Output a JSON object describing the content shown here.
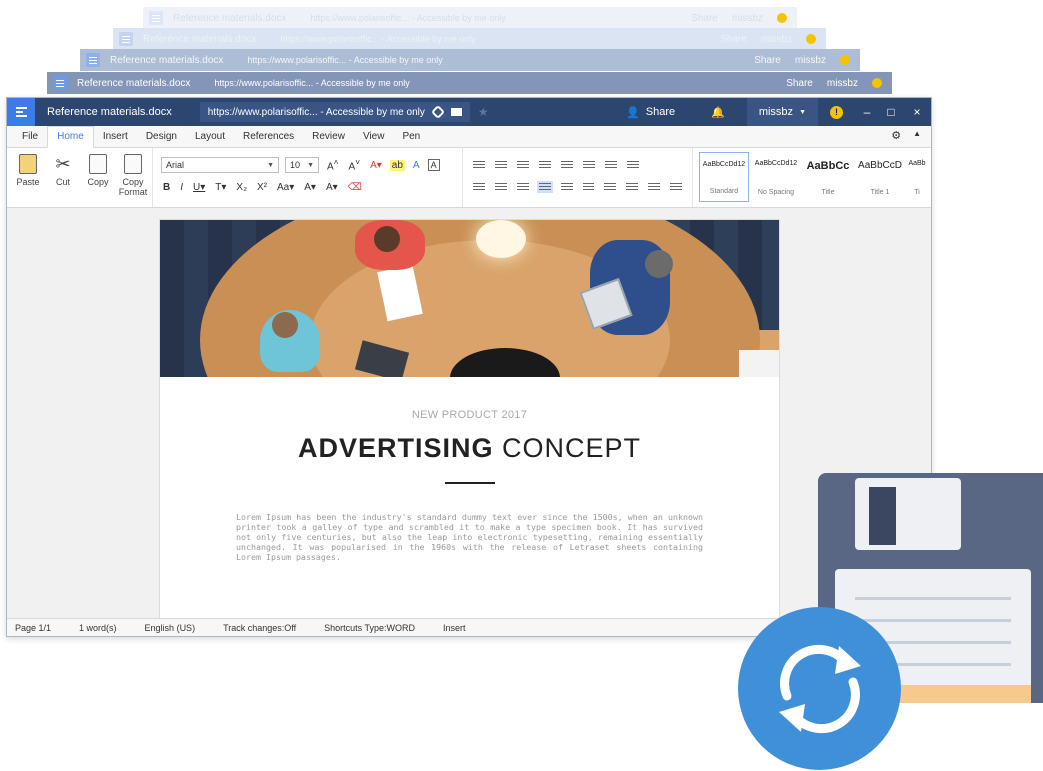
{
  "ghost_windows": [
    {
      "title": "Reference materials.docx",
      "url": "https://www.polarisoffic... - Accessible by me only",
      "share": "Share",
      "user": "missbz"
    },
    {
      "title": "Reference materials.docx",
      "url": "https://www.polarisoffic... - Accessible by me only",
      "share": "Share",
      "user": "missbz"
    },
    {
      "title": "Reference materials.docx",
      "url": "https://www.polarisoffic... - Accessible by me only",
      "share": "Share",
      "user": "missbz"
    },
    {
      "title": "Reference materials.docx",
      "url": "https://www.polarisoffic... - Accessible by me only",
      "share": "Share",
      "user": "missbz"
    }
  ],
  "titlebar": {
    "doc_name": "Reference materials.docx",
    "url": "https://www.polarisoffic... - Accessible by me only",
    "share_label": "Share",
    "user": "missbz",
    "notice": "!",
    "minimize": "–",
    "maximize": "□",
    "close": "×"
  },
  "tabs": [
    "File",
    "Home",
    "Insert",
    "Design",
    "Layout",
    "References",
    "Review",
    "View",
    "Pen"
  ],
  "active_tab": "Home",
  "clipboard": {
    "paste": "Paste",
    "cut": "Cut",
    "copy": "Copy",
    "copy_format": "Copy Format"
  },
  "font": {
    "family": "Arial",
    "size": "10"
  },
  "styles": [
    {
      "preview": "AaBbCcDd12",
      "name": "Standard"
    },
    {
      "preview": "AaBbCcDd12",
      "name": "No Spacing"
    },
    {
      "preview": "AaBbCc",
      "name": "Title"
    },
    {
      "preview": "AaBbCcD",
      "name": "Title 1"
    },
    {
      "preview": "AaBb",
      "name": "Ti"
    }
  ],
  "document": {
    "subtitle": "NEW PRODUCT 2017",
    "title_bold": "ADVERTISING",
    "title_rest": " CONCEPT",
    "body": "Lorem Ipsum has been the industry's standard dummy text ever since the 1500s, when an unknown printer took a galley of type and scrambled it to make a type specimen book. It has survived not only five centuries, but also the leap into electronic typesetting, remaining essentially unchanged. It was popularised in the 1960s with the release of Letraset sheets containing Lorem Ipsum passages."
  },
  "status": {
    "page": "Page 1/1",
    "words": "1 word(s)",
    "language": "English (US)",
    "track": "Track changes:Off",
    "shortcuts": "Shortcuts Type:WORD",
    "mode": "Insert"
  },
  "colors": {
    "titlebar": "#2c4670",
    "accent": "#3d7ce8",
    "sync": "#3f8fd9",
    "floppy": "#5a6784"
  }
}
